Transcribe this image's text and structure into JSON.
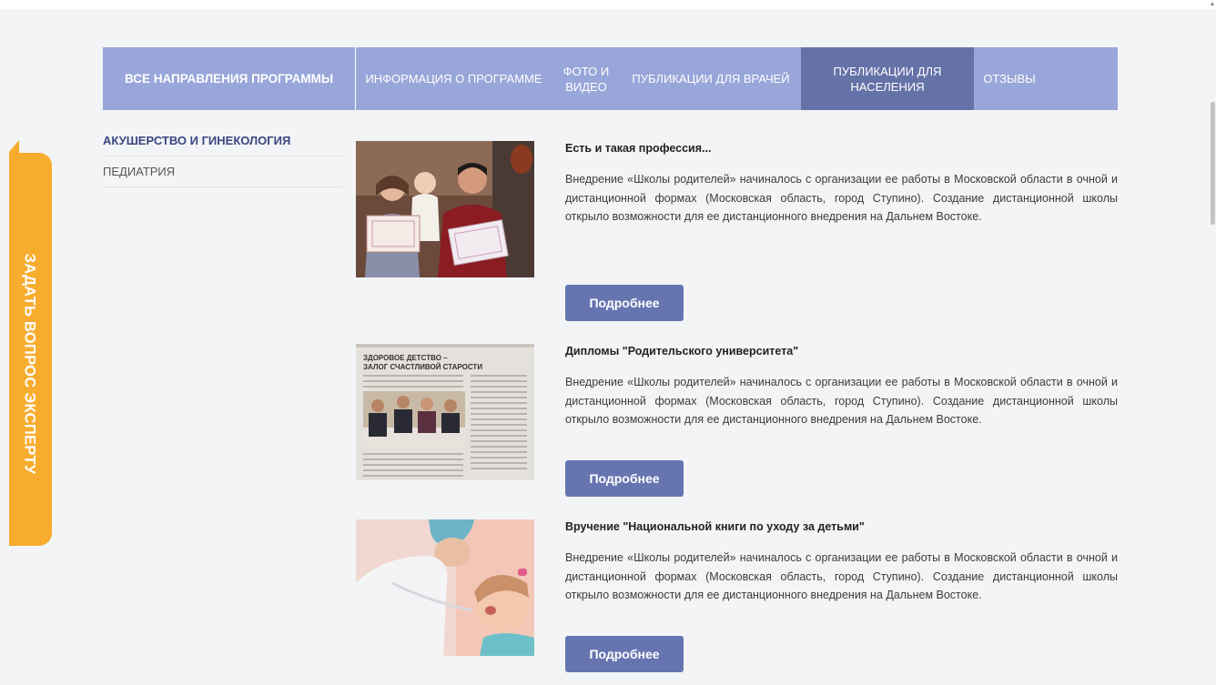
{
  "nav": {
    "all": "ВСЕ НАПРАВЛЕНИЯ ПРОГРАММЫ",
    "info": "ИНФОРМАЦИЯ О ПРОГРАММЕ",
    "photo": "ФОТО И ВИДЕО",
    "doctors": "ПУБЛИКАЦИИ ДЛЯ ВРАЧЕЙ",
    "population": "ПУБЛИКАЦИИ ДЛЯ НАСЕЛЕНИЯ",
    "reviews": "ОТЗЫВЫ",
    "active": "population"
  },
  "side_tab": {
    "label": "ЗАДАТЬ ВОПРОС ЭКСПЕРТУ"
  },
  "categories": [
    {
      "label": "АКУШЕРСТВО И ГИНЕКОЛОГИЯ",
      "active": true
    },
    {
      "label": "ПЕДИАТРИЯ",
      "active": false
    }
  ],
  "articles": [
    {
      "title": "Есть и такая профессия...",
      "text": "Внедрение «Школы родителей» начиналось с организации ее работы в Московской области в очной и дистанционной формах (Московская область, город Ступино). Создание дистанционной школы открыло возможности для ее дистанционного внедрения на Дальнем Востоке.",
      "button": "Подробнее"
    },
    {
      "title": "Дипломы \"Родительского университета\"",
      "text": "Внедрение «Школы родителей» начиналось с организации ее работы в Московской области в очной и дистанционной формах (Московская область, город Ступино). Создание дистанционной школы открыло возможности для ее дистанционного внедрения на Дальнем Востоке.",
      "button": "Подробнее",
      "thumb_headline": "ЗДОРОВОЕ ДЕТСТВО – ЗАЛОГ СЧАСТЛИВОЙ СТАРОСТИ"
    },
    {
      "title": "Вручение \"Национальной книги по уходу за детьми\"",
      "text": "Внедрение «Школы родителей» начиналось с организации ее работы в Московской области в очной и дистанционной формах (Московская область, город Ступино). Создание дистанционной школы открыло возможности для ее дистанционного внедрения на Дальнем Востоке.",
      "button": "Подробнее"
    }
  ],
  "colors": {
    "nav_bg": "#98a6d9",
    "nav_active": "#6572a8",
    "button": "#6675b0",
    "side_tab": "#f7ac2e"
  }
}
